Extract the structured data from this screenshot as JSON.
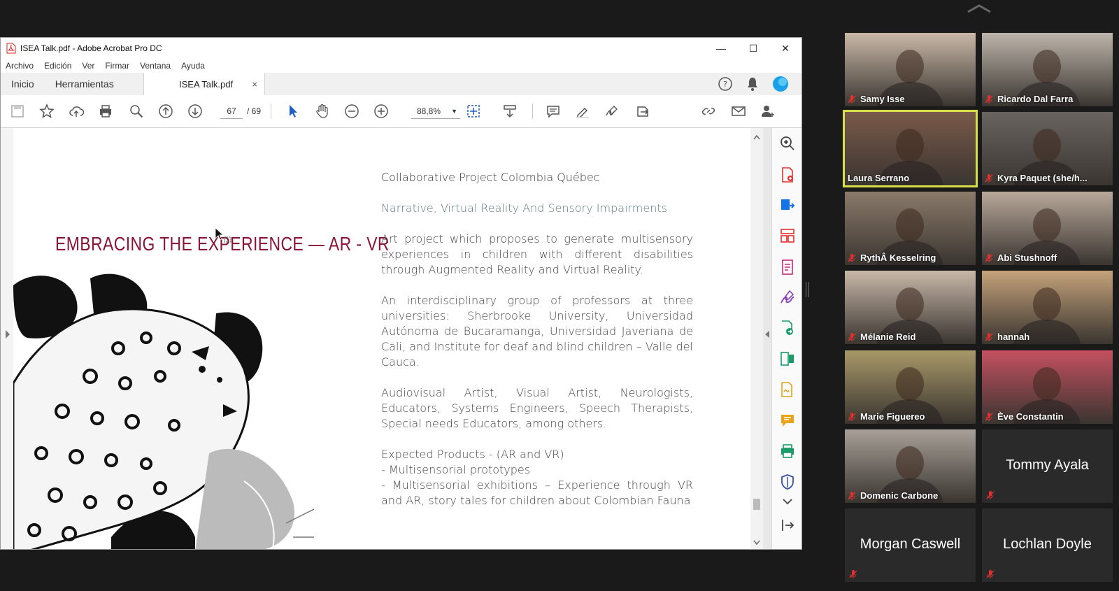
{
  "window": {
    "title": "ISEA Talk.pdf - Adobe Acrobat Pro DC",
    "minimize": "—",
    "maximize": "☐",
    "close": "✕"
  },
  "menu": [
    "Archivo",
    "Edición",
    "Ver",
    "Firmar",
    "Ventana",
    "Ayuda"
  ],
  "tabs": {
    "home": "Inicio",
    "tools": "Herramientas",
    "document": "ISEA Talk.pdf",
    "close": "×"
  },
  "toolbar": {
    "page_current": "67",
    "page_total": "/ 69",
    "zoom": "88,8%"
  },
  "pdf": {
    "title": "EMBRACING THE EXPERIENCE — AR - VR",
    "heading1": "Collaborative Project Colombia Québec",
    "heading2": "Narrative, Virtual Reality And Sensory Impairments",
    "para1": "Art project which proposes to generate multisensory experiences in children with different disabilities through Augmented Reality and Virtual Reality.",
    "para2": "An interdisciplinary group of professors at three universities: Sherbrooke University, Universidad Autónoma de Bucaramanga, Universidad Javeriana de Cali, and Institute for deaf and blind children – Valle del Cauca.",
    "para3": "Audiovisual Artist, Visual Artist, Neurologists, Educators, Systems Engineers, Speech Therapists, Special needs Educators, among others.",
    "list_title": "Expected Products  - (AR and VR)",
    "list_item1": "- Multisensorial prototypes",
    "list_item2": "- Multisensorial exhibitions – Experience through VR and AR, story tales for children about Colombian Fauna"
  },
  "participants": [
    {
      "name": "Samy Isse",
      "muted": true,
      "video": true,
      "color": "#c9b8a8"
    },
    {
      "name": "Ricardo Dal Farra",
      "muted": true,
      "video": true,
      "color": "#bdb5ab"
    },
    {
      "name": "Laura Serrano",
      "muted": false,
      "video": true,
      "color": "#7a5a4a",
      "active": true
    },
    {
      "name": "Kyra Paquet (she/h...",
      "muted": true,
      "video": true,
      "color": "#6a6460"
    },
    {
      "name": "RythÂ Kesselring",
      "muted": true,
      "video": true,
      "color": "#8a7a6a"
    },
    {
      "name": "Abi Stushnoff",
      "muted": true,
      "video": true,
      "color": "#b8a89a"
    },
    {
      "name": "Mélanie Reid",
      "muted": true,
      "video": true,
      "color": "#c8b8a8"
    },
    {
      "name": "hannah",
      "muted": true,
      "video": true,
      "color": "#c4a27a"
    },
    {
      "name": "Marie Figuereo",
      "muted": true,
      "video": true,
      "color": "#a89868"
    },
    {
      "name": "Ève Constantin",
      "muted": true,
      "video": true,
      "color": "#c45060"
    },
    {
      "name": "Domenic Carbone",
      "muted": true,
      "video": true,
      "color": "#a8a098"
    },
    {
      "name": "Tommy Ayala",
      "muted": true,
      "video": false
    },
    {
      "name": "Morgan Caswell",
      "muted": true,
      "video": false
    },
    {
      "name": "Lochlan Doyle",
      "muted": true,
      "video": false
    }
  ],
  "icons": {
    "toolbar": [
      "save-icon",
      "bookmark-star-icon",
      "upload-cloud-icon",
      "print-icon",
      "search-icon",
      "page-up-icon",
      "page-down-icon",
      "select-cursor-icon",
      "hand-tool-icon",
      "zoom-out-icon",
      "zoom-in-icon",
      "fit-page-icon",
      "scroll-mode-icon",
      "comment-icon",
      "highlight-pen-icon",
      "sign-icon",
      "export-icon",
      "link-icon",
      "email-icon",
      "add-user-icon"
    ],
    "right_panel": [
      "zoom-icon",
      "create-pdf-icon",
      "export-pdf-icon",
      "organize-pages-icon",
      "edit-pdf-icon",
      "fill-sign-icon",
      "send-review-icon",
      "compress-icon",
      "request-sign-icon",
      "comment-icon",
      "print-production-icon",
      "protect-icon",
      "more-icon",
      "collapse-panel-icon"
    ]
  },
  "colors": {
    "title_red": "#8a1538",
    "muted_red": "#e03131",
    "active_border": "#d7e04a",
    "acrobat_blue": "#1473e6"
  }
}
